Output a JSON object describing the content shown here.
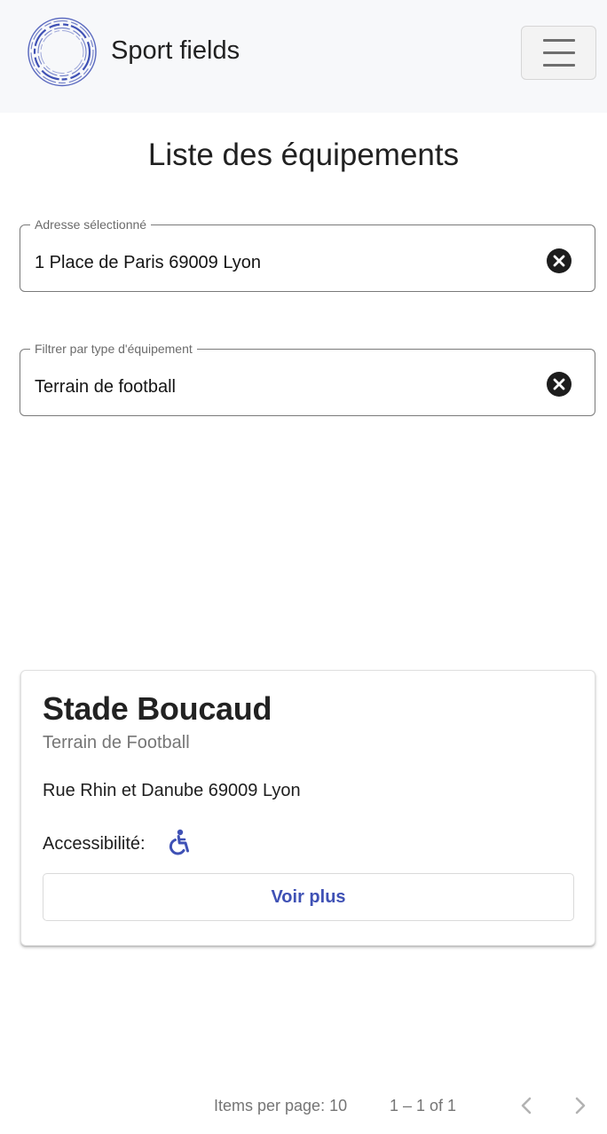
{
  "navbar": {
    "brand": "Sport fields",
    "logo_icon": "circle-ring-logo-icon",
    "menu_icon": "hamburger-menu-icon"
  },
  "page": {
    "title": "Liste des équipements"
  },
  "address_field": {
    "label": "Adresse sélectionné",
    "value": "1 Place de Paris 69009 Lyon",
    "clear_icon": "close-circle-icon"
  },
  "type_field": {
    "label": "Filtrer par type d'équipement",
    "value": "Terrain de football",
    "clear_icon": "close-circle-icon"
  },
  "results": [
    {
      "name": "Stade Boucaud",
      "type": "Terrain de Football",
      "address": "Rue Rhin et Danube 69009 Lyon",
      "accessibility_label": "Accessibilité:",
      "accessibility_icon": "wheelchair-icon",
      "button_label": "Voir plus"
    }
  ],
  "paginator": {
    "items_per_page": "Items per page: 10",
    "range": "1 – 1 of 1",
    "prev_icon": "chevron-left-icon",
    "next_icon": "chevron-right-icon"
  },
  "colors": {
    "accent": "#3f51b5",
    "navbar_bg": "#f7f8fa"
  }
}
